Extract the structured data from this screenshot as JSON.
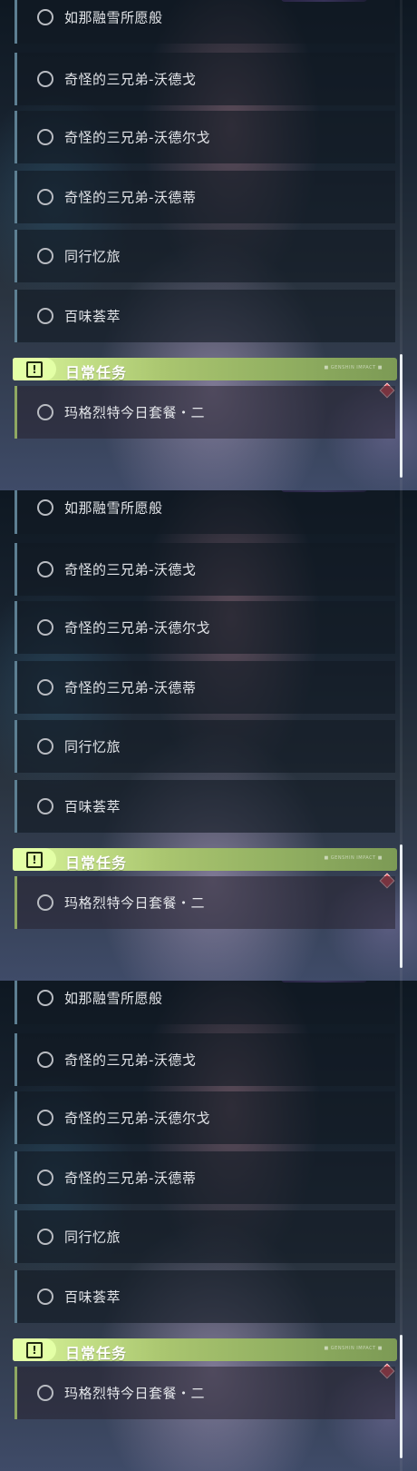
{
  "quest_list": {
    "items": [
      "如那融雪所愿般",
      "奇怪的三兄弟-沃德戈",
      "奇怪的三兄弟-沃德尔戈",
      "奇怪的三兄弟-沃德蒂",
      "同行忆旅",
      "百味荟萃"
    ],
    "daily_section": {
      "title": "日常任务",
      "badge_icon": "exclamation-icon",
      "tag_text": "■ GENSHIN IMPACT ■",
      "items": [
        "玛格烈特今日套餐・二"
      ]
    }
  },
  "colors": {
    "daily_header": "#a9c56f",
    "marker": "#d94a55",
    "quest_border": "#5d7f92"
  }
}
